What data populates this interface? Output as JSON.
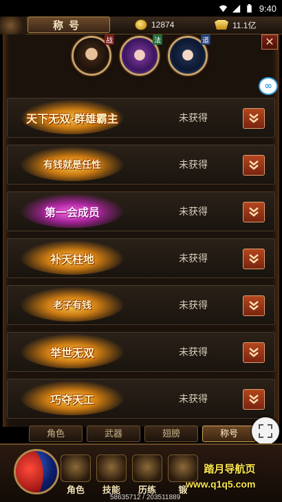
{
  "status_bar": {
    "time": "9:40"
  },
  "header": {
    "title": "称号"
  },
  "currency": {
    "gold": "12874",
    "ingot": "11.1亿"
  },
  "avatars": [
    {
      "class_tag": "战"
    },
    {
      "class_tag": "法"
    },
    {
      "class_tag": "道"
    }
  ],
  "titles": [
    {
      "name": "天下无双·群雄霸主",
      "status": "未获得",
      "style": "gold"
    },
    {
      "name": "有钱就是任性",
      "status": "未获得",
      "style": "gold"
    },
    {
      "name": "第一会成员",
      "status": "未获得",
      "style": "pink"
    },
    {
      "name": "补天柱地",
      "status": "未获得",
      "style": "gold"
    },
    {
      "name": "老子有钱",
      "status": "未获得",
      "style": "gold"
    },
    {
      "name": "举世无双",
      "status": "未获得",
      "style": "gold"
    },
    {
      "name": "巧夺天工",
      "status": "未获得",
      "style": "gold"
    }
  ],
  "tabs": [
    {
      "label": "角色",
      "active": false
    },
    {
      "label": "武器",
      "active": false
    },
    {
      "label": "翅膀",
      "active": false
    },
    {
      "label": "称号",
      "active": true
    }
  ],
  "nav": [
    {
      "label": "角色"
    },
    {
      "label": "技能"
    },
    {
      "label": "历练"
    },
    {
      "label": "锻"
    }
  ],
  "exp_text": "58635712 / 203511889",
  "watermark": {
    "line1": "踏月导航页",
    "line2": "www.q1q5.com"
  }
}
